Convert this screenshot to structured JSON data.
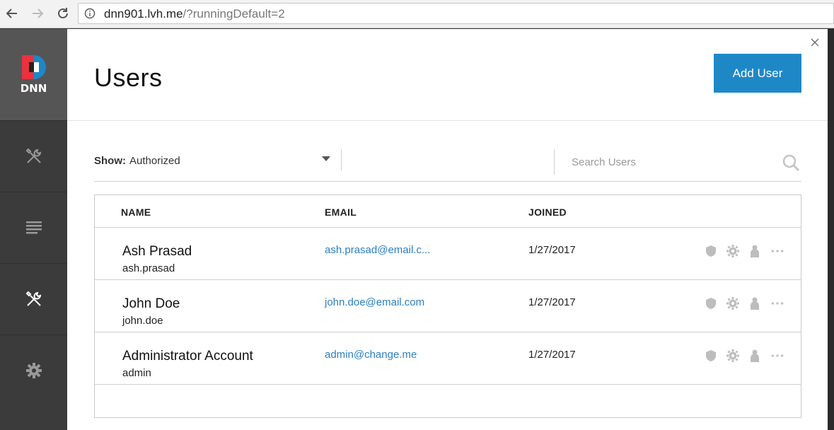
{
  "browser": {
    "url_host": "dnn901.lvh.me",
    "url_path": "/?runningDefault=2"
  },
  "sidebar": {
    "logo_text": "DNN",
    "items": [
      {
        "icon": "tools-icon",
        "active": false
      },
      {
        "icon": "list-icon",
        "active": false
      },
      {
        "icon": "tools-icon",
        "active": true
      },
      {
        "icon": "gear-icon",
        "active": false
      }
    ]
  },
  "header": {
    "title": "Users",
    "add_user_label": "Add User"
  },
  "filter": {
    "show_label": "Show:",
    "show_value": "Authorized",
    "search_placeholder": "Search Users"
  },
  "table": {
    "columns": [
      "NAME",
      "EMAIL",
      "JOINED"
    ],
    "rows": [
      {
        "name": "Ash Prasad",
        "username": "ash.prasad",
        "email": "ash.prasad@email.c...",
        "joined": "1/27/2017"
      },
      {
        "name": "John Doe",
        "username": "john.doe",
        "email": "john.doe@email.com",
        "joined": "1/27/2017"
      },
      {
        "name": "Administrator Account",
        "username": "admin",
        "email": "admin@change.me",
        "joined": "1/27/2017"
      }
    ]
  },
  "colors": {
    "accent": "#1e88c7",
    "sidebar_bg": "#3b3b3b",
    "link": "#2b7fc1"
  }
}
